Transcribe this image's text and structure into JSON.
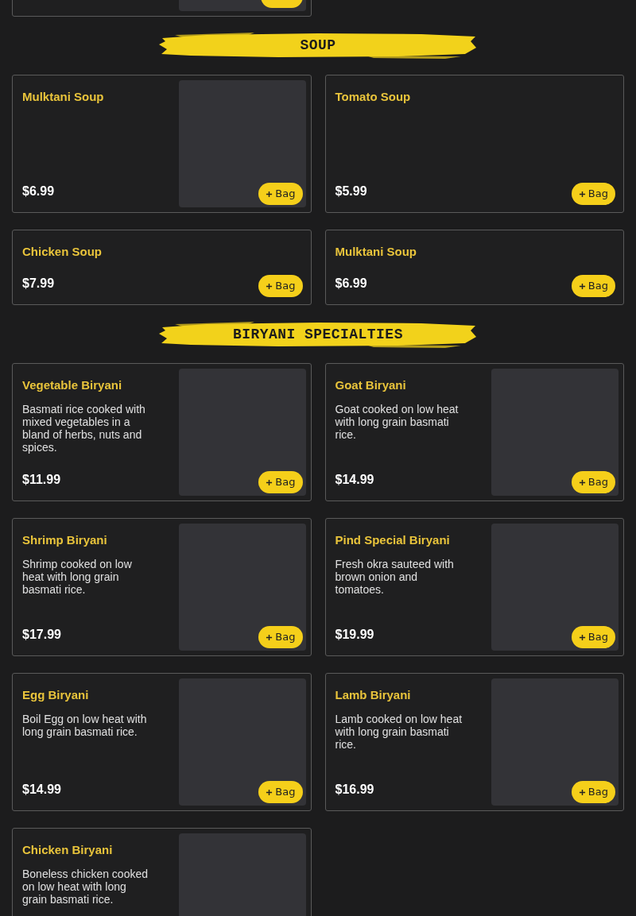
{
  "sections": [
    {
      "title": "SOUP",
      "items": [
        {
          "kind": "with-image",
          "name": "Mulktani Soup",
          "price": "$6.99",
          "button": "Bag"
        },
        {
          "kind": "text-only",
          "name": "Tomato Soup",
          "price": "$5.99",
          "button": "Bag",
          "tall": true
        },
        {
          "kind": "text-only",
          "name": "Chicken Soup",
          "price": "$7.99",
          "button": "Bag"
        },
        {
          "kind": "text-only",
          "name": "Mulktani Soup",
          "price": "$6.99",
          "button": "Bag"
        }
      ]
    },
    {
      "title": "BIRYANI SPECIALTIES",
      "items": [
        {
          "kind": "with-image",
          "name": "Vegetable Biryani",
          "description": "Basmati rice cooked with mixed vegetables in a bland of herbs, nuts and spices.",
          "price": "$11.99",
          "button": "Bag"
        },
        {
          "kind": "with-image",
          "name": "Goat Biryani",
          "description": "Goat cooked on low heat with long grain basmati rice.",
          "price": "$14.99",
          "button": "Bag"
        },
        {
          "kind": "with-image",
          "name": "Shrimp Biryani",
          "description": "Shrimp cooked on low heat with long grain basmati rice.",
          "price": "$17.99",
          "button": "Bag"
        },
        {
          "kind": "with-image",
          "name": "Pind Special Biryani",
          "description": "Fresh okra sauteed with brown onion and tomatoes.",
          "price": "$19.99",
          "button": "Bag"
        },
        {
          "kind": "with-image",
          "name": "Egg Biryani",
          "description": "Boil Egg on low heat with long grain basmati rice.",
          "price": "$14.99",
          "button": "Bag"
        },
        {
          "kind": "with-image",
          "name": "Lamb Biryani",
          "description": "Lamb cooked on low heat with long grain basmati rice.",
          "price": "$16.99",
          "button": "Bag"
        },
        {
          "kind": "with-image",
          "name": "Chicken Biryani",
          "description": "Boneless chicken cooked on low heat with long grain basmati rice."
        }
      ]
    }
  ]
}
